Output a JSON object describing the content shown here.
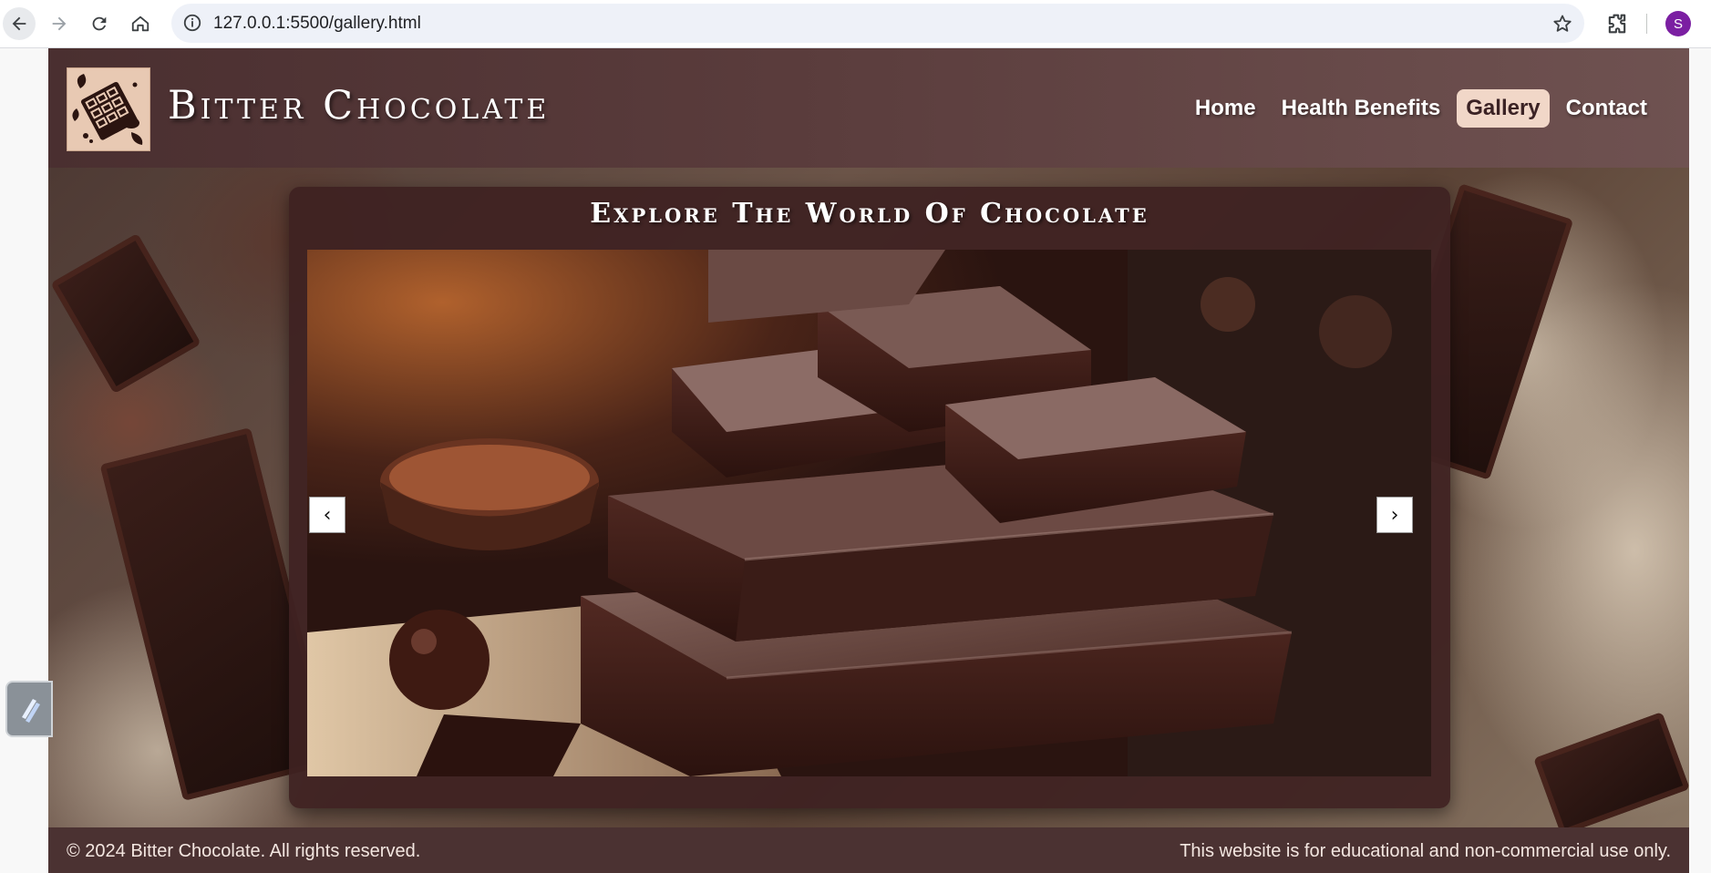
{
  "browser": {
    "url": "127.0.0.1:5500/gallery.html",
    "profile_initial": "S",
    "profile_color": "#7b1fa2"
  },
  "site": {
    "brand": "Bitter Chocolate",
    "nav": [
      {
        "label": "Home",
        "active": false
      },
      {
        "label": "Health Benefits",
        "active": false
      },
      {
        "label": "Gallery",
        "active": true
      },
      {
        "label": "Contact",
        "active": false
      }
    ],
    "colors": {
      "header": "#5a3c3c",
      "active_nav_bg": "#f1d7c8",
      "card_bg": "#3e2121",
      "footer": "#4b3232"
    }
  },
  "gallery": {
    "title": "Explore The World Of Chocolate",
    "prev_arrow": "‹",
    "next_arrow": "›"
  },
  "footer": {
    "copyright": "© 2024 Bitter Chocolate. All rights reserved.",
    "note": "This website is for educational and non-commercial use only."
  }
}
